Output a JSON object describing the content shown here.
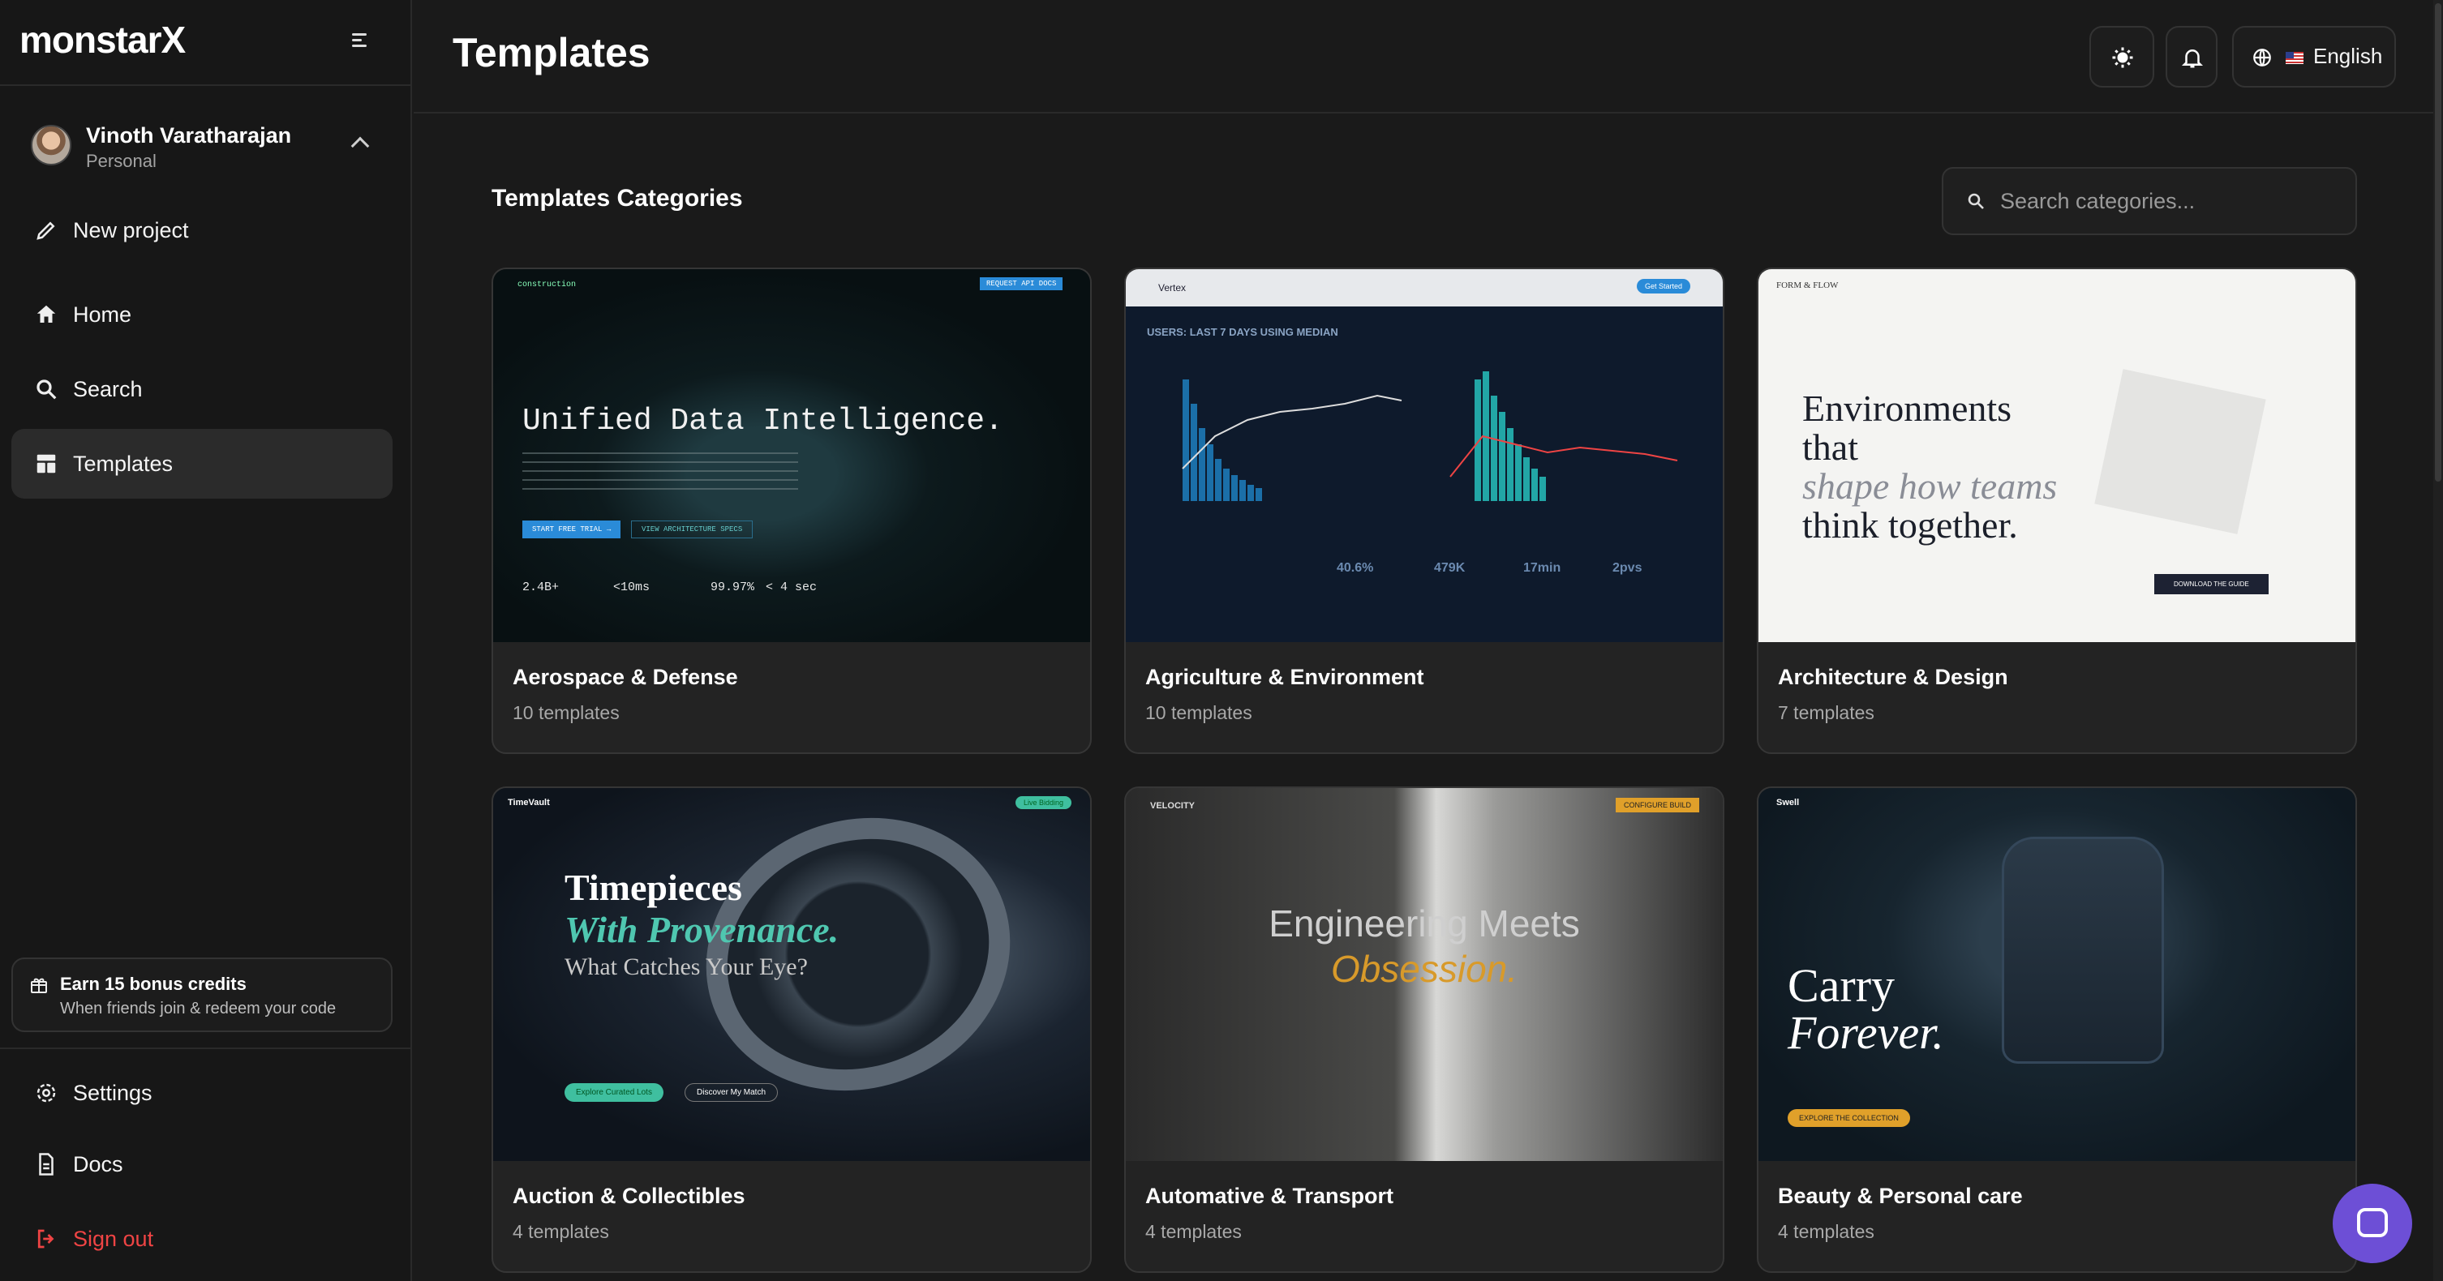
{
  "app": {
    "logo_text": "monstarX"
  },
  "user": {
    "name": "Vinoth Varatharajan",
    "workspace": "Personal"
  },
  "nav": {
    "new_project": "New project",
    "home": "Home",
    "search": "Search",
    "templates": "Templates"
  },
  "referral": {
    "title": "Earn 15 bonus credits",
    "subtitle": "When friends join & redeem your code"
  },
  "footer_nav": {
    "settings": "Settings",
    "docs": "Docs",
    "sign_out": "Sign out"
  },
  "header": {
    "title": "Templates",
    "language": "English"
  },
  "main": {
    "section_title": "Templates Categories",
    "search_placeholder": "Search categories..."
  },
  "categories": [
    {
      "name": "Aerospace & Defense",
      "count": "10 templates"
    },
    {
      "name": "Agriculture & Environment",
      "count": "10 templates"
    },
    {
      "name": "Architecture & Design",
      "count": "7 templates"
    },
    {
      "name": "Auction & Collectibles",
      "count": "4 templates"
    },
    {
      "name": "Automative & Transport",
      "count": "4 templates"
    },
    {
      "name": "Beauty & Personal care",
      "count": "4 templates"
    }
  ],
  "thumbnails": {
    "aero": {
      "brand": "construction",
      "headline": "Unified Data Intelligence.",
      "cta": "START FREE TRIAL →",
      "cta2": "VIEW ARCHITECTURE SPECS",
      "badge": "REQUEST API DOCS",
      "stats": [
        "2.4B+",
        "<10ms",
        "99.97%",
        "< 4 sec"
      ]
    },
    "agri": {
      "brand": "Vertex",
      "heading": "USERS: LAST 7 DAYS USING MEDIAN",
      "button": "Get Started",
      "metrics": [
        "40.6%",
        "479K",
        "17min",
        "2pvs"
      ]
    },
    "arch": {
      "brand": "FORM & FLOW",
      "line1": "Environments",
      "line2": "that",
      "line3": "shape how teams",
      "line4": "think together.",
      "cta": "DOWNLOAD THE GUIDE"
    },
    "auct": {
      "brand": "TimeVault",
      "line1": "Timepieces",
      "line2": "With Provenance.",
      "line3": "What Catches Your Eye?",
      "btn1": "Explore Curated Lots",
      "btn2": "Discover My Match",
      "live": "Live Bidding"
    },
    "auto": {
      "brand": "VELOCITY",
      "line1": "Engineering Meets",
      "line2": "Obsession.",
      "cta": "CONFIGURE BUILD"
    },
    "beau": {
      "brand": "Swell",
      "line1": "Carry",
      "line2": "Forever.",
      "cta": "EXPLORE THE COLLECTION"
    }
  },
  "colors": {
    "accent": "#6d4fd6",
    "danger": "#ef4444",
    "surface": "#232323",
    "background": "#1a1a1a"
  }
}
